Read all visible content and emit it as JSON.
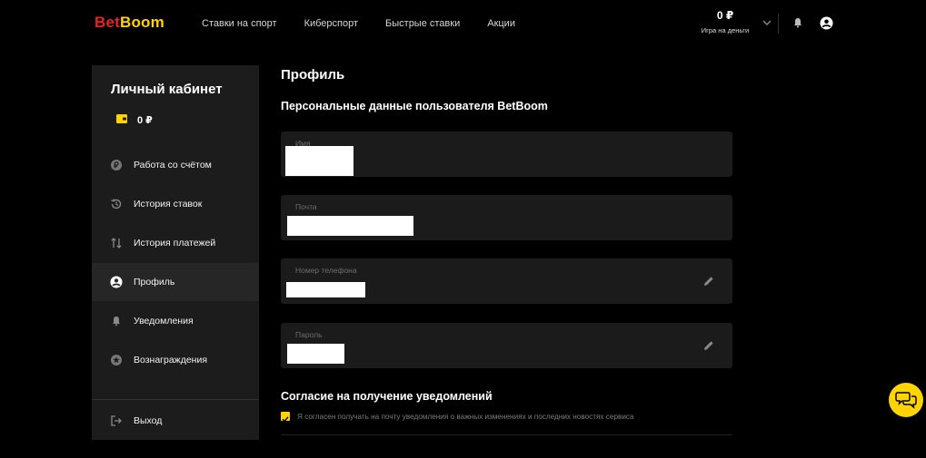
{
  "header": {
    "logo_part1": "Bet",
    "logo_part2": "Boom",
    "nav": [
      "Ставки на спорт",
      "Киберспорт",
      "Быстрые ставки",
      "Акции"
    ],
    "balance": "0 ₽",
    "balance_label": "Игра на деньги",
    "icons": [
      "chevron-down-icon",
      "bell-icon",
      "user-icon"
    ]
  },
  "sidebar": {
    "title": "Личный кабинет",
    "wallet_balance": "0 ₽",
    "items": [
      {
        "label": "Работа со счётом",
        "icon": "ruble-coin-icon"
      },
      {
        "label": "История ставок",
        "icon": "history-icon"
      },
      {
        "label": "История платежей",
        "icon": "transfer-arrows-icon"
      },
      {
        "label": "Профиль",
        "icon": "user-icon",
        "active": true
      },
      {
        "label": "Уведомления",
        "icon": "bell-icon"
      },
      {
        "label": "Вознаграждения",
        "icon": "star-icon"
      }
    ],
    "logout": "Выход"
  },
  "main": {
    "title": "Профиль",
    "section": "Персональные данные пользователя BetBoom",
    "fields": [
      {
        "label": "Имя",
        "value": ""
      },
      {
        "label": "Почта",
        "value": ""
      },
      {
        "label": "Номер телефона",
        "value": ""
      },
      {
        "label": "Пароль",
        "value": ""
      }
    ],
    "consent_title": "Согласие на получение уведомлений",
    "consent_text": "Я согласен получать на почту уведомления о важных изменениях и последних новостях сервиса",
    "consent_checked": true
  },
  "colors": {
    "accent": "#ffd400",
    "logo_red": "#e8231f",
    "background": "#000000",
    "panel": "#1c1c1c"
  }
}
